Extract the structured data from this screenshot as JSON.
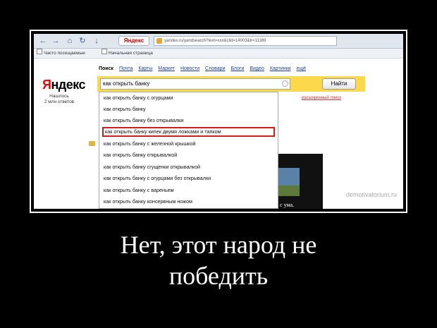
{
  "browser": {
    "nav": {
      "back": "←",
      "forward": "→",
      "home": "⌂",
      "refresh": "↻",
      "down": "↓"
    },
    "tab_label": "Яндекс",
    "url": "yandex.ru/yandsearch?text=xxx&clid=14003&lr=11169"
  },
  "bookmarks": {
    "frequent": "Часто посещаемые",
    "start": "Начальная страница"
  },
  "yandex": {
    "logo_first": "Я",
    "logo_rest": "ндекс",
    "found_line1": "Нашлось",
    "found_line2": "2 млн ответов",
    "services": [
      "Поиск",
      "Почта",
      "Карты",
      "Маркет",
      "Новости",
      "Словари",
      "Блоги",
      "Видео",
      "Картинки"
    ],
    "services_more": "ещё",
    "search_value": "как открыть банку",
    "find_button": "Найти",
    "advanced_link": "расширенный поиск",
    "suggestions": [
      "как открыть банку с огурцами",
      "как открыть банку",
      "как открыть банку без открывалки",
      "как открыть банку кипек двумя ложками и тапком",
      "как открыть банку с железной крышкой",
      "как открыть банку открывалкой",
      "как открыть банку сгущенки открывалкой",
      "как открыть банку с огурцами без открывалки",
      "как открыть банку с вареньем",
      "как открыть банку консервным ножом"
    ],
    "highlighted_index": 3
  },
  "image_caption": "ет с ума.",
  "watermark": "demotivatorium.ru",
  "caption_line1": "Нет, этот народ не",
  "caption_line2": "победить"
}
